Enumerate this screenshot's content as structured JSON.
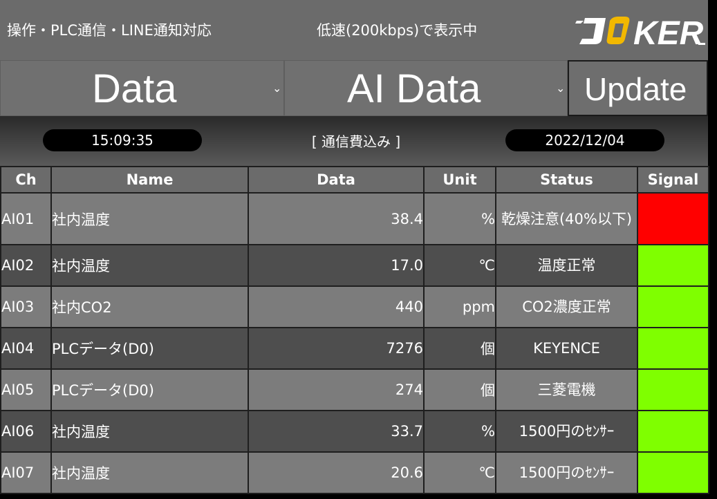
{
  "header": {
    "left_text": "操作・PLC通信・LINE通知対応",
    "mid_text": "低速(200kbps)で表示中",
    "logo_text": "JOKER"
  },
  "selectors": {
    "first": "Data",
    "second": "AI Data",
    "chevron": "⌄",
    "update_label": "Update"
  },
  "status_bar": {
    "time": "15:09:35",
    "comm": "[ 通信費込み ]",
    "date": "2022/12/04"
  },
  "table": {
    "columns": [
      "Ch",
      "Name",
      "Data",
      "Unit",
      "Status",
      "Signal"
    ],
    "rows": [
      {
        "ch": "AI01",
        "name": "社内温度",
        "data": "38.4",
        "unit": "%",
        "status": "乾燥注意(40%以下)",
        "signal": "#ff0000"
      },
      {
        "ch": "AI02",
        "name": "社内温度",
        "data": "17.0",
        "unit": "℃",
        "status": "温度正常",
        "signal": "#7fff00"
      },
      {
        "ch": "AI03",
        "name": "社内CO2",
        "data": "440",
        "unit": "ppm",
        "status": "CO2濃度正常",
        "signal": "#7fff00"
      },
      {
        "ch": "AI04",
        "name": "PLCデータ(D0)",
        "data": "7276",
        "unit": "個",
        "status": "KEYENCE",
        "signal": "#7fff00"
      },
      {
        "ch": "AI05",
        "name": "PLCデータ(D0)",
        "data": "274",
        "unit": "個",
        "status": "三菱電機",
        "signal": "#7fff00"
      },
      {
        "ch": "AI06",
        "name": "社内温度",
        "data": "33.7",
        "unit": "%",
        "status": "1500円のｾﾝｻｰ",
        "signal": "#7fff00"
      },
      {
        "ch": "AI07",
        "name": "社内温度",
        "data": "20.6",
        "unit": "℃",
        "status": "1500円のｾﾝｻｰ",
        "signal": "#7fff00"
      }
    ]
  }
}
